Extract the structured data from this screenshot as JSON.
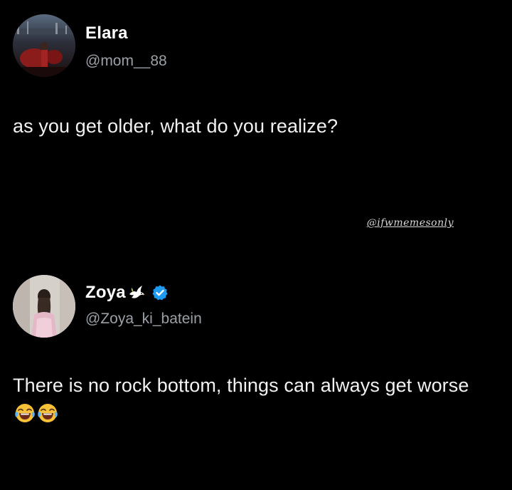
{
  "posts": [
    {
      "author_name": "Elara",
      "handle": "@mom__88",
      "text": "as you get older, what do you realize?"
    },
    {
      "author_name": "Zoya",
      "handle": "@Zoya_ki_batein",
      "text": "There is no rock bottom, things can always get worse",
      "verified": true,
      "name_icons": [
        "dove-icon",
        "verified-badge-icon"
      ],
      "trailing_emojis": [
        "face-with-tears-of-joy-emoji",
        "face-with-tears-of-joy-emoji"
      ]
    }
  ],
  "watermark": "@ifwmemesonly",
  "colors": {
    "background": "#000000",
    "text": "#f1f1f1",
    "handle": "#9aa0a6",
    "verified": "#1d9bf0"
  }
}
